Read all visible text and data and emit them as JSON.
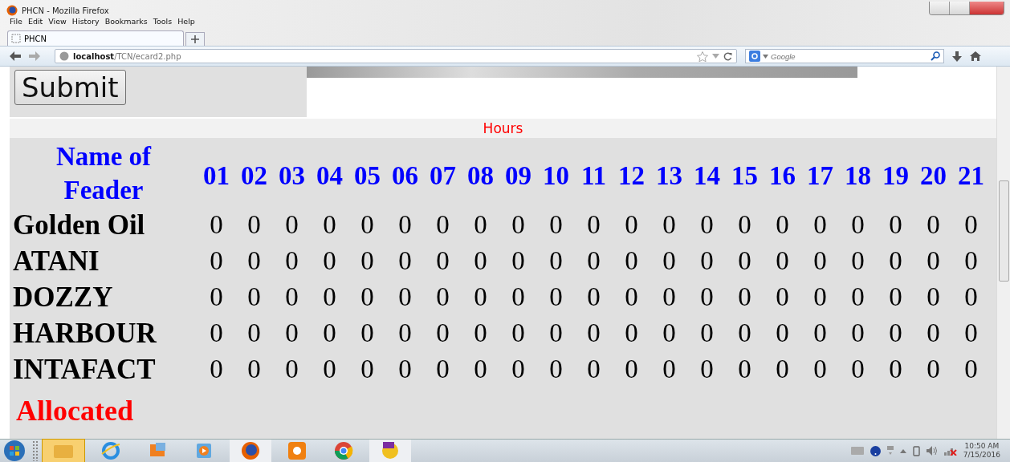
{
  "window": {
    "title": "PHCN - Mozilla Firefox"
  },
  "menu": [
    "File",
    "Edit",
    "View",
    "History",
    "Bookmarks",
    "Tools",
    "Help"
  ],
  "tabs": [
    {
      "label": "PHCN",
      "selected": true
    }
  ],
  "address_bar": {
    "host": "localhost",
    "path": "/TCN/ecard2.php"
  },
  "search": {
    "placeholder": "Google"
  },
  "form": {
    "submit": "Submit"
  },
  "hours_label": "Hours",
  "table": {
    "name_header": "Name of Feader",
    "hours": [
      "01",
      "02",
      "03",
      "04",
      "05",
      "06",
      "07",
      "08",
      "09",
      "10",
      "11",
      "12",
      "13",
      "14",
      "15",
      "16",
      "17",
      "18",
      "19",
      "20",
      "21"
    ],
    "rows": [
      {
        "name": "Golden Oil",
        "values": [
          "0",
          "0",
          "0",
          "0",
          "0",
          "0",
          "0",
          "0",
          "0",
          "0",
          "0",
          "0",
          "0",
          "0",
          "0",
          "0",
          "0",
          "0",
          "0",
          "0",
          "0"
        ]
      },
      {
        "name": "ATANI",
        "values": [
          "0",
          "0",
          "0",
          "0",
          "0",
          "0",
          "0",
          "0",
          "0",
          "0",
          "0",
          "0",
          "0",
          "0",
          "0",
          "0",
          "0",
          "0",
          "0",
          "0",
          "0"
        ]
      },
      {
        "name": "DOZZY",
        "values": [
          "0",
          "0",
          "0",
          "0",
          "0",
          "0",
          "0",
          "0",
          "0",
          "0",
          "0",
          "0",
          "0",
          "0",
          "0",
          "0",
          "0",
          "0",
          "0",
          "0",
          "0"
        ]
      },
      {
        "name": "HARBOUR",
        "values": [
          "0",
          "0",
          "0",
          "0",
          "0",
          "0",
          "0",
          "0",
          "0",
          "0",
          "0",
          "0",
          "0",
          "0",
          "0",
          "0",
          "0",
          "0",
          "0",
          "0",
          "0"
        ]
      },
      {
        "name": "INTAFACT",
        "values": [
          "0",
          "0",
          "0",
          "0",
          "0",
          "0",
          "0",
          "0",
          "0",
          "0",
          "0",
          "0",
          "0",
          "0",
          "0",
          "0",
          "0",
          "0",
          "0",
          "0",
          "0"
        ]
      }
    ]
  },
  "allocated_label": "Allocated",
  "taskbar": {
    "clock_time": "10:50 AM",
    "clock_date": "7/15/2016"
  }
}
